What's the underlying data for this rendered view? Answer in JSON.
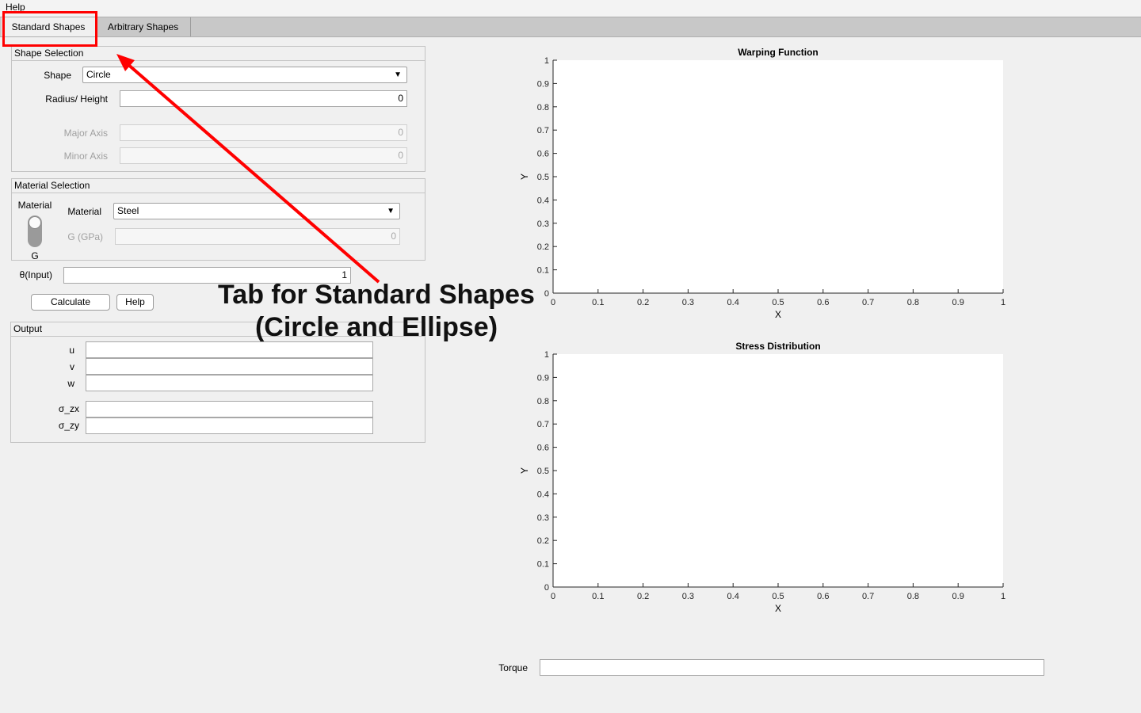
{
  "menubar": {
    "help": "Help"
  },
  "tabs": {
    "standard": "Standard Shapes",
    "arbitrary": "Arbitrary Shapes"
  },
  "shape_selection": {
    "title": "Shape Selection",
    "shape_label": "Shape",
    "shape_value": "Circle",
    "radius_label": "Radius/ Height",
    "radius_value": "0",
    "major_label": "Major Axis",
    "major_value": "0",
    "minor_label": "Minor Axis",
    "minor_value": "0"
  },
  "material_selection": {
    "title": "Material Selection",
    "switch_top_label": "Material",
    "switch_bottom_label": "G",
    "material_label": "Material",
    "material_value": "Steel",
    "g_label": "G (GPa)",
    "g_value": "0"
  },
  "theta": {
    "label": "θ(Input)",
    "value": "1"
  },
  "buttons": {
    "calculate": "Calculate",
    "help": "Help"
  },
  "output": {
    "title": "Output",
    "u_label": "u",
    "v_label": "v",
    "w_label": "w",
    "szx_label": "σ_zx",
    "szy_label": "σ_zy"
  },
  "torque": {
    "label": "Torque",
    "value": ""
  },
  "annotation": {
    "line1": "Tab for Standard Shapes",
    "line2": "(Circle and Ellipse)"
  },
  "colors": {
    "annotation": "#ff0000",
    "panel_bg": "#f0f0f0",
    "axes_bg": "#ffffff"
  },
  "chart_data": [
    {
      "type": "line",
      "title": "Warping Function",
      "xlabel": "X",
      "ylabel": "Y",
      "xlim": [
        0,
        1
      ],
      "ylim": [
        0,
        1
      ],
      "xticks": [
        "0",
        "0.1",
        "0.2",
        "0.3",
        "0.4",
        "0.5",
        "0.6",
        "0.7",
        "0.8",
        "0.9",
        "1"
      ],
      "yticks": [
        "0",
        "0.1",
        "0.2",
        "0.3",
        "0.4",
        "0.5",
        "0.6",
        "0.7",
        "0.8",
        "0.9",
        "1"
      ],
      "series": []
    },
    {
      "type": "line",
      "title": "Stress Distribution",
      "xlabel": "X",
      "ylabel": "Y",
      "xlim": [
        0,
        1
      ],
      "ylim": [
        0,
        1
      ],
      "xticks": [
        "0",
        "0.1",
        "0.2",
        "0.3",
        "0.4",
        "0.5",
        "0.6",
        "0.7",
        "0.8",
        "0.9",
        "1"
      ],
      "yticks": [
        "0",
        "0.1",
        "0.2",
        "0.3",
        "0.4",
        "0.5",
        "0.6",
        "0.7",
        "0.8",
        "0.9",
        "1"
      ],
      "series": []
    }
  ]
}
